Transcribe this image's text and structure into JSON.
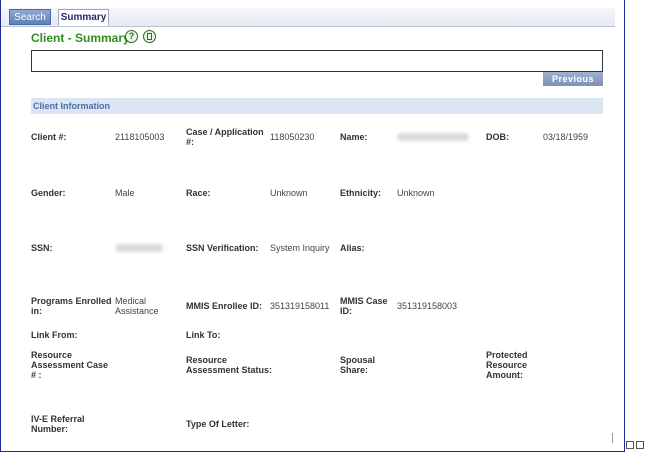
{
  "tabs": {
    "search": "Search",
    "summary": "Summary"
  },
  "page": {
    "title": "Client - Summary",
    "help_icon_glyph": "?"
  },
  "buttons": {
    "previous": "Previous"
  },
  "section": {
    "title": "Client Information"
  },
  "fields": {
    "client_num_label": "Client #:",
    "client_num_value": "2118105003",
    "case_app_label_1": "Case / Application",
    "case_app_label_2": "#:",
    "case_app_value": "118050230",
    "name_label": "Name:",
    "dob_label": "DOB:",
    "dob_value": "03/18/1959",
    "gender_label": "Gender:",
    "gender_value": "Male",
    "race_label": "Race:",
    "race_value": "Unknown",
    "ethnicity_label": "Ethnicity:",
    "ethnicity_value": "Unknown",
    "ssn_label": "SSN:",
    "ssn_verification_label": "SSN Verification:",
    "ssn_verification_value": "System Inquiry",
    "alias_label": "Alias:",
    "programs_label_1": "Programs Enrolled",
    "programs_label_2": "in:",
    "programs_value_1": "Medical",
    "programs_value_2": "Assistance",
    "mmis_enrollee_label": "MMIS Enrollee ID:",
    "mmis_enrollee_value": "351319158011",
    "mmis_case_label_1": "MMIS Case",
    "mmis_case_label_2": "ID:",
    "mmis_case_value": "351319158003",
    "link_from_label": "Link From:",
    "link_to_label": "Link To:",
    "resource_case_label_1": "Resource",
    "resource_case_label_2": "Assessment Case",
    "resource_case_label_3": "# :",
    "resource_status_label_1": "Resource",
    "resource_status_label_2": "Assessment Status:",
    "spousal_label_1": "Spousal",
    "spousal_label_2": "Share:",
    "protected_label_1": "Protected",
    "protected_label_2": "Resource",
    "protected_label_3": "Amount:",
    "ive_label_1": "IV-E Referral",
    "ive_label_2": "Number:",
    "type_letter_label": "Type Of Letter:"
  }
}
